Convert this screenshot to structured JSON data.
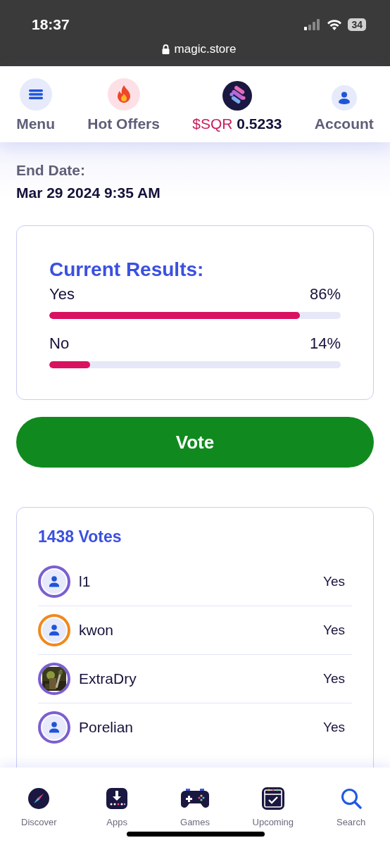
{
  "status_bar": {
    "time": "18:37",
    "battery": "34",
    "url": "magic.store"
  },
  "header": {
    "items": [
      {
        "kind": "menu",
        "label": "Menu"
      },
      {
        "kind": "hot",
        "label": "Hot Offers"
      },
      {
        "kind": "price",
        "label": "$SQR",
        "value": "0.5233"
      },
      {
        "kind": "account",
        "label": "Account"
      }
    ]
  },
  "end_date": {
    "label": "End Date:",
    "value": "Mar 29 2024 9:35 AM"
  },
  "results": {
    "title": "Current Results:",
    "options": [
      {
        "label": "Yes",
        "percent": "86%",
        "level": 0.86
      },
      {
        "label": "No",
        "percent": "14%",
        "level": 0.14
      }
    ]
  },
  "vote_button": "Vote",
  "votes": {
    "count": "1438 Votes",
    "voters": [
      {
        "name": "l1",
        "vote": "Yes",
        "color": "#7b5fd0",
        "kind": "person"
      },
      {
        "name": "kwon",
        "vote": "Yes",
        "color": "#f0891c",
        "kind": "person"
      },
      {
        "name": "ExtraDry",
        "vote": "Yes",
        "color": "#7b5fd0",
        "kind": "picture"
      },
      {
        "name": "Porelian",
        "vote": "Yes",
        "color": "#7b5fd0",
        "kind": "person"
      }
    ]
  },
  "bottom_nav": [
    {
      "kind": "discover",
      "label": "Discover"
    },
    {
      "kind": "apps",
      "label": "Apps"
    },
    {
      "kind": "games",
      "label": "Games"
    },
    {
      "kind": "upcoming",
      "label": "Upcoming"
    },
    {
      "kind": "search",
      "label": "Search"
    }
  ]
}
